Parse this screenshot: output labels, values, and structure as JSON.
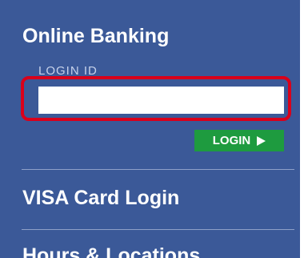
{
  "online_banking": {
    "title": "Online Banking",
    "login_id_label": "LOGIN ID",
    "login_id_value": "",
    "login_button_label": "LOGIN",
    "login_button_icon": "play-icon"
  },
  "nav": {
    "items": [
      {
        "label": "VISA Card Login"
      },
      {
        "label": "Hours & Locations"
      }
    ]
  },
  "colors": {
    "panel_background": "#3b5998",
    "highlight_border": "#d9001b",
    "login_button": "#1e9b3f",
    "text": "#ffffff"
  }
}
